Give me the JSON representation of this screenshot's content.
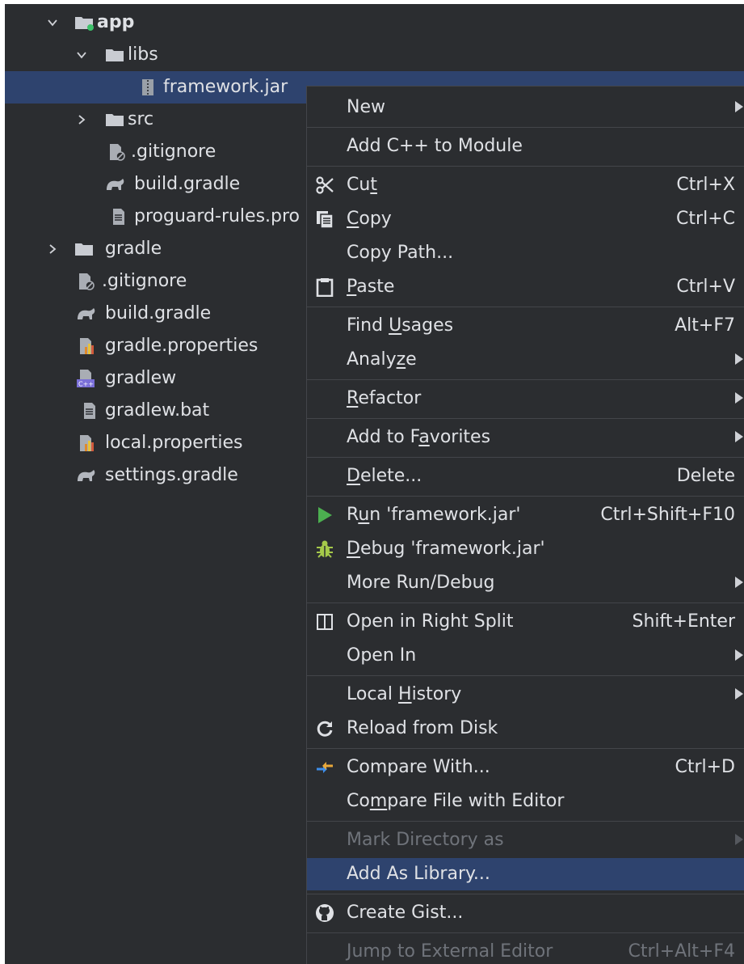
{
  "tree": {
    "app": "app",
    "libs": "libs",
    "framework_jar": "framework.jar",
    "src": "src",
    "app_gitignore": ".gitignore",
    "app_build_gradle": "build.gradle",
    "proguard": "proguard-rules.pro",
    "gradle": "gradle",
    "root_gitignore": ".gitignore",
    "root_build_gradle": "build.gradle",
    "gradle_properties": "gradle.properties",
    "gradlew": "gradlew",
    "gradlew_bat": "gradlew.bat",
    "local_properties": "local.properties",
    "settings_gradle": "settings.gradle"
  },
  "menu": {
    "new": "New",
    "add_cpp": "Add C++ to Module",
    "cut": {
      "pre": "Cu",
      "u": "t",
      "post": "",
      "shortcut": "Ctrl+X"
    },
    "copy": {
      "pre": "",
      "u": "C",
      "post": "opy",
      "shortcut": "Ctrl+C"
    },
    "copy_path": "Copy Path...",
    "paste": {
      "pre": "",
      "u": "P",
      "post": "aste",
      "shortcut": "Ctrl+V"
    },
    "find_usages": {
      "pre": "Find ",
      "u": "U",
      "post": "sages",
      "shortcut": "Alt+F7"
    },
    "analyze": {
      "pre": "Analy",
      "u": "z",
      "post": "e"
    },
    "refactor": {
      "pre": "",
      "u": "R",
      "post": "efactor"
    },
    "add_favorites": {
      "pre": "Add to F",
      "u": "a",
      "post": "vorites"
    },
    "delete": {
      "pre": "",
      "u": "D",
      "post": "elete...",
      "shortcut": "Delete"
    },
    "run": {
      "pre": "R",
      "u": "u",
      "post": "n 'framework.jar'",
      "shortcut": "Ctrl+Shift+F10"
    },
    "debug": {
      "pre": "",
      "u": "D",
      "post": "ebug 'framework.jar'"
    },
    "more_run": "More Run/Debug",
    "open_right": {
      "label": "Open in Right Split",
      "shortcut": "Shift+Enter"
    },
    "open_in": "Open In",
    "local_history": {
      "pre": "Local ",
      "u": "H",
      "post": "istory"
    },
    "reload": "Reload from Disk",
    "compare_with": {
      "label": "Compare With...",
      "shortcut": "Ctrl+D"
    },
    "compare_file": {
      "pre": "Co",
      "u": "m",
      "post": "pare File with Editor"
    },
    "mark_dir": "Mark Directory as",
    "add_library": "Add As Library...",
    "create_gist": "Create Gist...",
    "jump_ext": {
      "label": "Jump to External Editor",
      "shortcut": "Ctrl+Alt+F4"
    }
  },
  "colors": {
    "background": "#2b2d30",
    "selection": "#2e436e",
    "text": "#dfe1e5",
    "disabled_text": "#6f737a",
    "run_green": "#4caf50",
    "debug_yellow": "#a5c94a"
  },
  "icons": {
    "folder": "folder-icon",
    "module": "module-folder-icon",
    "jar": "jar-icon",
    "gitignore": "gitignore-icon",
    "gradle": "gradle-elephant-icon",
    "text_file": "text-file-icon",
    "properties": "properties-file-icon",
    "script": "script-file-icon",
    "cut": "scissors-icon",
    "copy": "copy-icon",
    "paste": "clipboard-icon",
    "run": "run-triangle-icon",
    "debug": "bug-icon",
    "split": "split-view-icon",
    "reload": "reload-icon",
    "compare": "compare-arrows-icon",
    "github": "github-icon"
  }
}
